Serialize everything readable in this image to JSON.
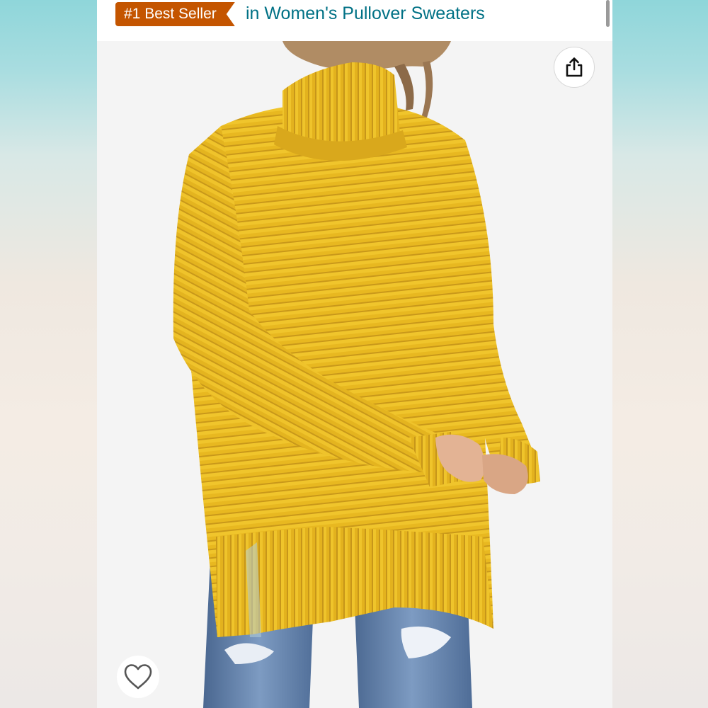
{
  "header": {
    "badge_label": "#1 Best Seller",
    "category_link": "in Women's Pullover Sweaters"
  },
  "colors": {
    "badge": "#c45500",
    "link": "#007185",
    "sweater": "#e8b820",
    "jeans": "#5b7aa3"
  },
  "product_image": {
    "subject": "yellow ribbed turtleneck pullover sweater with side slits",
    "icon": "product-photo"
  },
  "actions": {
    "share_icon": "share-icon",
    "wishlist_icon": "heart-icon"
  }
}
